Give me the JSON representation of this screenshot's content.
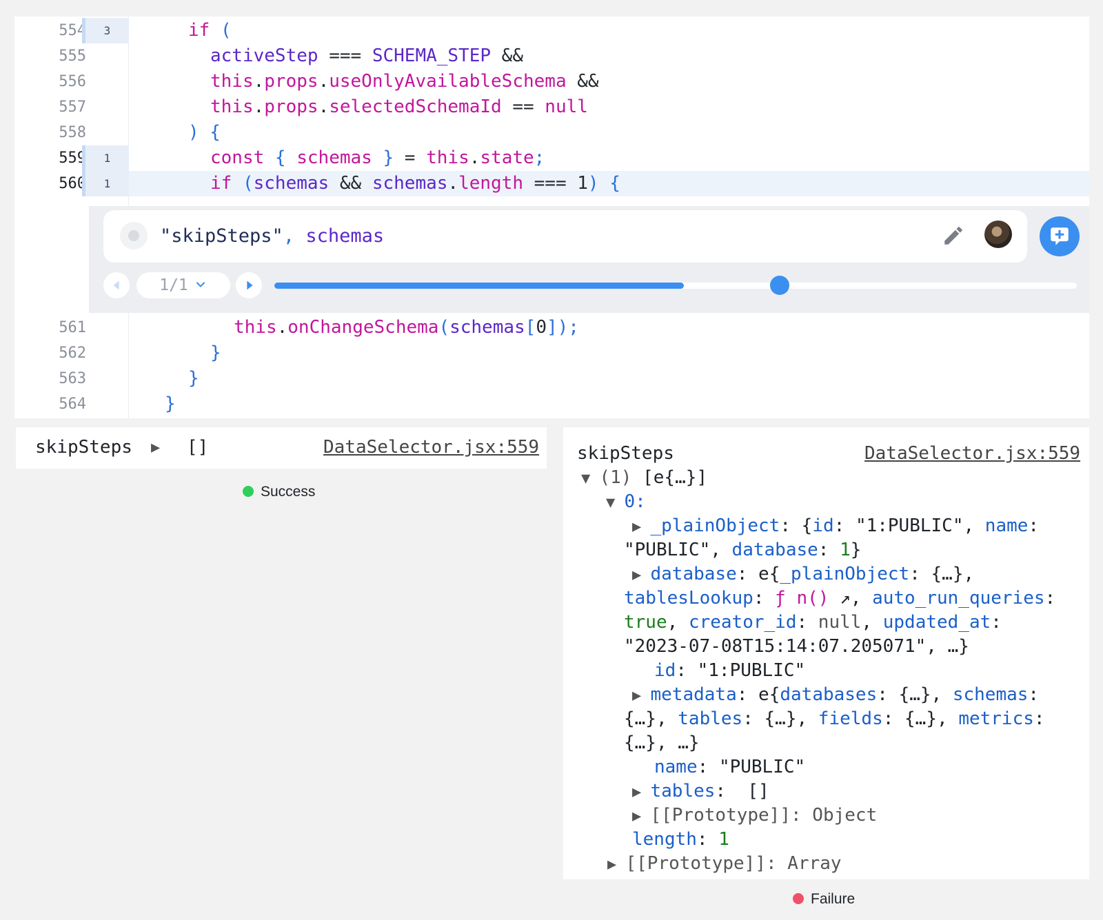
{
  "editor": {
    "lines": [
      {
        "num": "554",
        "hits": "3"
      },
      {
        "num": "555",
        "hits": ""
      },
      {
        "num": "556",
        "hits": ""
      },
      {
        "num": "557",
        "hits": ""
      },
      {
        "num": "558",
        "hits": ""
      },
      {
        "num": "559",
        "hits": "1"
      },
      {
        "num": "560",
        "hits": "1"
      },
      {
        "num": "561",
        "hits": ""
      },
      {
        "num": "562",
        "hits": ""
      },
      {
        "num": "563",
        "hits": ""
      },
      {
        "num": "564",
        "hits": ""
      }
    ],
    "code": {
      "l554_kw": "if",
      "l554_p": " (",
      "l555_a": "activeStep",
      "l555_op": " === ",
      "l555_b": "SCHEMA_STEP",
      "l555_and": " &&",
      "l556_this": "this",
      "l556_dot1": ".",
      "l556_props": "props",
      "l556_dot2": ".",
      "l556_prop": "useOnlyAvailableSchema",
      "l556_and": " &&",
      "l557_this": "this",
      "l557_dot1": ".",
      "l557_props": "props",
      "l557_dot2": ".",
      "l557_prop": "selectedSchemaId",
      "l557_op": " == ",
      "l557_null": "null",
      "l558_close": ") {",
      "l559_const": "const",
      "l559_lb": " { ",
      "l559_var": "schemas",
      "l559_rb": " }",
      "l559_eq": " = ",
      "l559_this": "this",
      "l559_dot": ".",
      "l559_state": "state",
      "l559_semi": ";",
      "l560_if": "if",
      "l560_p": " (",
      "l560_a": "schemas",
      "l560_and": " && ",
      "l560_b": "schemas",
      "l560_dot": ".",
      "l560_len": "length",
      "l560_op": " === ",
      "l560_num": "1",
      "l560_close": ") {",
      "l561_this": "this",
      "l561_dot": ".",
      "l561_fn": "onChangeSchema",
      "l561_p": "(",
      "l561_arg": "schemas",
      "l561_lb": "[",
      "l561_idx": "0",
      "l561_rb": "]",
      "l561_end": ");",
      "l562": "}",
      "l563": "}",
      "l564": "}"
    }
  },
  "logpoint": {
    "expr_str": "\"skipSteps\"",
    "expr_comma": ", ",
    "expr_var": "schemas",
    "pager_label": "1/1",
    "progress": 0.51,
    "thumb_pos": 0.63,
    "icons": [
      "dot-icon",
      "pencil-icon",
      "avatar",
      "add-comment-icon",
      "prev-icon",
      "chevron-down-icon",
      "next-icon"
    ],
    "accent": "#3b8ff0"
  },
  "console_left": {
    "label": "skipSteps",
    "value": "[]",
    "source": "DataSelector.jsx:559",
    "status": "Success",
    "status_color": "#2fcf5a"
  },
  "console_right": {
    "label": "skipSteps",
    "source": "DataSelector.jsx:559",
    "status": "Failure",
    "status_color": "#f0506a",
    "tree": {
      "root_count": "(1)",
      "root_summary": "[e{…}]",
      "index": "0:",
      "plain_key": "_plainObject",
      "plain_val_1": "{",
      "plain_id_k": "id",
      "plain_id_v": "\"1:PUBLIC\"",
      "plain_name_k": "name",
      "plain_name_v": "\"PUBLIC\"",
      "plain_db_k": "database",
      "plain_db_v": "1",
      "db_key": "database",
      "db_val_e": "e{",
      "db_plain_k": "_plainObject",
      "db_plain_v": "{…}",
      "db_tl_k": "tablesLookup",
      "db_tl_f": "ƒ n()",
      "db_arq_k": "auto_run_queries",
      "db_true": "true",
      "db_creator_k": "creator_id",
      "db_null": "null",
      "db_upd_k": "updated_at",
      "db_upd_v": "\"2023-07-08T15:14:07.205071\"",
      "db_more": "…}",
      "id_k": "id",
      "id_v": "\"1:PUBLIC\"",
      "meta_k": "metadata",
      "meta_e": "e{",
      "meta_dbs_k": "databases",
      "meta_sch_k": "schemas",
      "meta_tbl_k": "tables",
      "meta_fld_k": "fields",
      "meta_met_k": "metrics",
      "meta_obj": "{…}",
      "meta_more": "…}",
      "name_k": "name",
      "name_v": "\"PUBLIC\"",
      "tables_k": "tables",
      "tables_v": "[]",
      "proto_obj": "[[Prototype]]: Object",
      "length_k": "length",
      "length_v": "1",
      "proto_arr": "[[Prototype]]: Array"
    }
  }
}
